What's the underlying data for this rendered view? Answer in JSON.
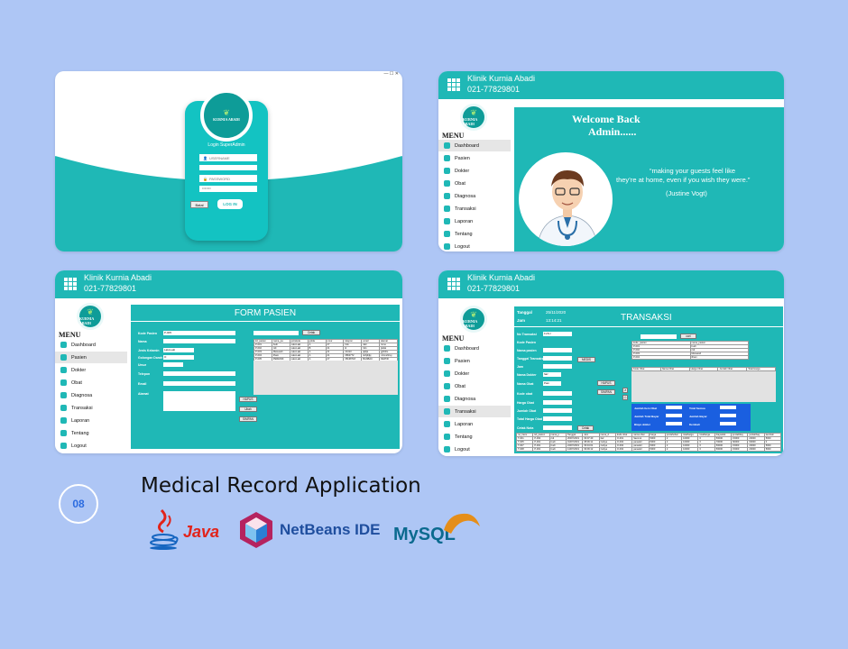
{
  "login": {
    "logo_text": "KURNIA ABADI",
    "title": "Login SuperAdmin",
    "username_placeholder": "USERNAME",
    "password_placeholder": "PASSWORD",
    "cancel_label": "Batal",
    "login_label": "LOG IN"
  },
  "header": {
    "clinic_name": "Klinik Kurnia Abadi",
    "phone": "021-77829801"
  },
  "menu": {
    "title": "MENU",
    "items": [
      "Dashboard",
      "Pasien",
      "Dokter",
      "Obat",
      "Diagnosa",
      "Transaksi",
      "Laporan",
      "Tentang",
      "Logout"
    ]
  },
  "dashboard": {
    "welcome_line1": "Welcome Back",
    "welcome_line2": "Admin......",
    "quote_line1": "“making your guests feel like",
    "quote_line2": "they’re at home, even if you wish they were.”",
    "quote_author": "(Justine Vogt)"
  },
  "form_pasien": {
    "title": "FORM PASIEN",
    "labels": [
      "Kode Pasien",
      "Nama",
      "Jenis Kelamin",
      "Golongan Darah",
      "Umur",
      "Telepon",
      "Email",
      "Alamat"
    ],
    "kode_value": "P-005",
    "jk_value": "Laki-Laki",
    "gol_value": "O",
    "search_button": "Cetak",
    "hapus_button": "HAPUS",
    "ubah_button": "Ubah",
    "simpan_button": "SIMPAN",
    "table": {
      "headers": [
        "kd_pasien",
        "nama_pa",
        "jeniskela",
        "golda",
        "umur",
        "telepon",
        "email",
        "alamat"
      ],
      "rows": [
        [
          "P-001",
          "budi",
          "Laki-Laki",
          "A",
          "27",
          "bdo",
          "dati",
          "tome"
        ],
        [
          "P-002",
          "ridi",
          "Laki-Laki",
          "B",
          "21",
          "kl",
          "hdn",
          "jkdsk"
        ],
        [
          "P-003",
          "Meisarah",
          "Laki-Laki",
          "A",
          "21",
          "21313",
          "jkjhjk",
          "jghhihs"
        ],
        [
          "P-004",
          "ilham",
          "Laki-Laki",
          "A",
          "21",
          "0862772",
          "ilohjihjkj",
          "mhmshhsy"
        ],
        [
          "P-005",
          "PERENNI",
          "Laki-Laki",
          "A",
          "27",
          "08138718",
          "BANBAU",
          "DEPOK"
        ]
      ]
    }
  },
  "transaksi": {
    "title": "TRANSAKSI",
    "tanggal_label": "Tanggal",
    "tanggal_value": "25/11/2020",
    "jam_label": "Jam",
    "jam_value": "13:14:21",
    "labels": [
      "No Transaksi",
      "Kode Pasien",
      "Nama pasien",
      "Tanggal Transaksi",
      "Jam",
      "Nama Dokter",
      "Nama Obat",
      "Kode obat",
      "Harga Obat",
      "Jumlah Obat",
      "Total Harga Obat",
      "Cetak Nota"
    ],
    "no_value": "1V1U",
    "dokter_value": "faiz",
    "obat_value": "Pain",
    "cari_button": "cari",
    "medis_button": "MEDIS",
    "hapus_button": "HAPUS",
    "simpan_button": "SIMPAN",
    "cetak_button": "Cetak",
    "pasien_table": {
      "headers": [
        "kode_pasien",
        "nama_pasien"
      ],
      "rows": [
        [
          "P-001",
          "budi"
        ],
        [
          "P-002",
          "ridi"
        ],
        [
          "P-003",
          "Meisarah"
        ],
        [
          "P-004",
          "ilham"
        ]
      ]
    },
    "obat_table": {
      "headers": [
        "Kode Obat",
        "Nama Obat",
        "Harga Obat",
        "Jumlah Obat",
        "Total Harga"
      ]
    },
    "summary": {
      "jumlah_item": "Jumlah Item Obat",
      "total_semua": "Total Semua",
      "jumlah_total": "Jumlah Total Bayar",
      "jumlah_bayar": "Jumlah Bayar",
      "biaya_dokter": "Biaya dokter",
      "kembali": "Kembali"
    },
    "table": {
      "headers": [
        "no_trans",
        "kd_pasien",
        "nama_p",
        "Tanggal",
        "Jam",
        "nama_d",
        "kode obat",
        "nama obat",
        "harga",
        "jumlahobat",
        "totalharga",
        "totalharga",
        "biayadok",
        "jumlahbay",
        "jumlahbay",
        "kembali"
      ],
      "rows": [
        [
          "T-001",
          "P-002",
          "ridi",
          "26/07/2019",
          "09:07:40",
          "faiz",
          "O-001",
          "Sanmol",
          "5000",
          "2",
          "10000",
          "0",
          "50000",
          "15000",
          "20000",
          "5000"
        ],
        [
          "T-005",
          "P-001",
          "budi",
          "01/07/2019",
          "08:09:11",
          "Cahya",
          "O-002",
          "panadol",
          "5000",
          "2",
          "10000",
          "0",
          "70000",
          "60000",
          "60000",
          "0"
        ],
        [
          "T-007",
          "P-001",
          "budi",
          "24/07/2019",
          "09:34:01",
          "Cahya",
          "O-002",
          "panadol",
          "5000",
          "2",
          "10000",
          "0",
          "50000",
          "15000",
          "20000",
          "5000"
        ],
        [
          "T-008",
          "P-001",
          "budi",
          "14/07/2019",
          "09:09:12",
          "Cahya",
          "O-002",
          "panadol",
          "5000",
          "2",
          "10000",
          "0",
          "50000",
          "15000",
          "20000",
          "5000"
        ]
      ]
    }
  },
  "caption": {
    "number": "08",
    "title": "Medical Record Application",
    "logos": [
      "Java",
      "NetBeans IDE",
      "MySQL"
    ]
  },
  "colors": {
    "background": "#aec6f5",
    "teal": "#1fb8b6",
    "summary_blue": "#1a5fe0"
  }
}
